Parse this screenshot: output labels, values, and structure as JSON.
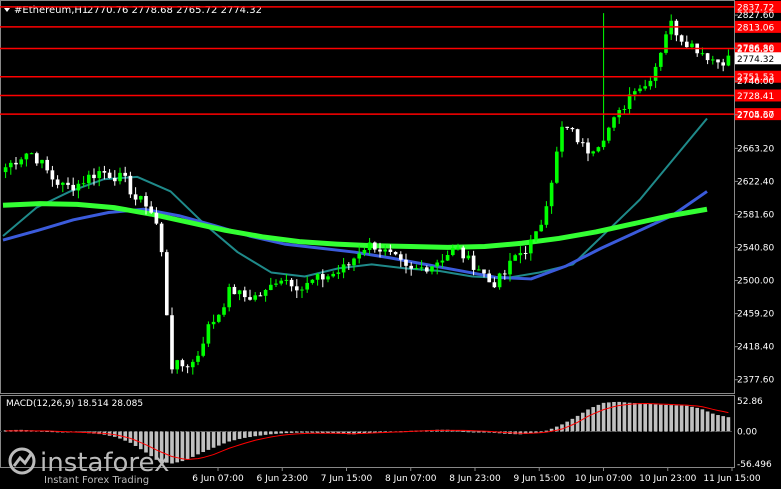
{
  "header": {
    "symbol": "#Ethereum,H1",
    "ohlc": "2770.76 2778.68 2765.72 2774.32"
  },
  "watermark": {
    "brand": "instaforex",
    "tagline": "Instant Forex Trading"
  },
  "colors": {
    "background": "#000000",
    "bull": "#00ff00",
    "bear": "#ffffff",
    "sr_line": "#ff0000",
    "ma_fast": "#1f8a8a",
    "ma_mid": "#3b5bdb",
    "ma_slow": "#33ff33",
    "macd_hist": "#c0c0c0",
    "macd_signal": "#ff0000",
    "frame": "#888888"
  },
  "chart_data": [
    {
      "type": "candlestick",
      "title": "#Ethereum,H1",
      "ylim": [
        2360,
        2845
      ],
      "y_ticks": [
        "2827.60",
        "2786.80",
        "2746.00",
        "2704.60",
        "2663.20",
        "2622.40",
        "2581.60",
        "2540.80",
        "2500.00",
        "2459.20",
        "2418.40",
        "2377.60"
      ],
      "x_ticks": [
        "6 Jun 07:00",
        "6 Jun 23:00",
        "7 Jun 15:00",
        "8 Jun 07:00",
        "8 Jun 23:00",
        "9 Jun 15:00",
        "10 Jun 07:00",
        "10 Jun 23:00",
        "11 Jun 15:00"
      ],
      "current_price": "2774.32",
      "levels": [
        {
          "label": "2837.72",
          "value": 2837.72
        },
        {
          "label": "2813.06",
          "value": 2813.06
        },
        {
          "label": "2786.36",
          "value": 2786.36
        },
        {
          "label": "2751.53",
          "value": 2751.53
        },
        {
          "label": "2728.41",
          "value": 2728.41
        },
        {
          "label": "2705.37",
          "value": 2705.37
        }
      ],
      "close_anchors": [
        2640,
        2650,
        2660,
        2645,
        2625,
        2615,
        2618,
        2628,
        2635,
        2630,
        2625,
        2600,
        2595,
        2560,
        2395,
        2395,
        2400,
        2440,
        2460,
        2490,
        2480,
        2480,
        2485,
        2505,
        2500,
        2490,
        2500,
        2505,
        2510,
        2520,
        2540,
        2545,
        2535,
        2525,
        2510,
        2515,
        2520,
        2530,
        2540,
        2525,
        2515,
        2495,
        2505,
        2530,
        2540,
        2560,
        2620,
        2690,
        2680,
        2660,
        2670,
        2690,
        2710,
        2740,
        2740,
        2770,
        2820,
        2800,
        2790,
        2780,
        2770,
        2774
      ],
      "moving_averages": [
        {
          "name": "ma_fast",
          "values": [
            2555,
            2590,
            2610,
            2625,
            2628,
            2610,
            2570,
            2535,
            2510,
            2505,
            2515,
            2520,
            2515,
            2512,
            2505,
            2503,
            2510,
            2520,
            2560,
            2600,
            2650,
            2700
          ]
        },
        {
          "name": "ma_mid",
          "values": [
            2550,
            2562,
            2575,
            2584,
            2588,
            2580,
            2568,
            2555,
            2545,
            2540,
            2535,
            2528,
            2520,
            2512,
            2504,
            2502,
            2518,
            2540,
            2560,
            2580,
            2610
          ]
        },
        {
          "name": "ma_slow",
          "values": [
            2593,
            2595,
            2594,
            2590,
            2582,
            2572,
            2562,
            2554,
            2548,
            2545,
            2543,
            2542,
            2541,
            2542,
            2546,
            2552,
            2560,
            2570,
            2580,
            2588
          ]
        }
      ]
    },
    {
      "type": "histogram",
      "title": "MACD(12,26,9) 18.514 28.085",
      "ylim": [
        -62,
        62
      ],
      "y_ticks": [
        "52.86",
        "0.00",
        "-56.496"
      ],
      "macd_anchors": [
        2,
        3,
        2,
        1,
        0,
        -1,
        -3,
        -5,
        -10,
        -20,
        -35,
        -52,
        -56,
        -50,
        -38,
        -28,
        -18,
        -12,
        -8,
        -5,
        -3,
        -2,
        -2,
        -3,
        -4,
        -5,
        -3,
        -1,
        0,
        1,
        2,
        3,
        3,
        1,
        -1,
        -2,
        -4,
        -5,
        -3,
        2,
        12,
        25,
        40,
        50,
        52,
        50,
        49,
        47,
        46,
        45,
        40,
        30,
        25
      ],
      "signal_anchors": [
        1,
        1,
        1,
        1,
        0,
        -1,
        -2,
        -3,
        -6,
        -12,
        -22,
        -34,
        -44,
        -49,
        -47,
        -40,
        -30,
        -22,
        -15,
        -10,
        -6,
        -4,
        -3,
        -3,
        -3,
        -4,
        -3,
        -2,
        -1,
        0,
        1,
        2,
        2,
        2,
        1,
        0,
        -2,
        -3,
        -3,
        -1,
        4,
        14,
        28,
        38,
        45,
        48,
        49,
        48,
        47,
        46,
        44,
        38,
        33
      ]
    }
  ]
}
